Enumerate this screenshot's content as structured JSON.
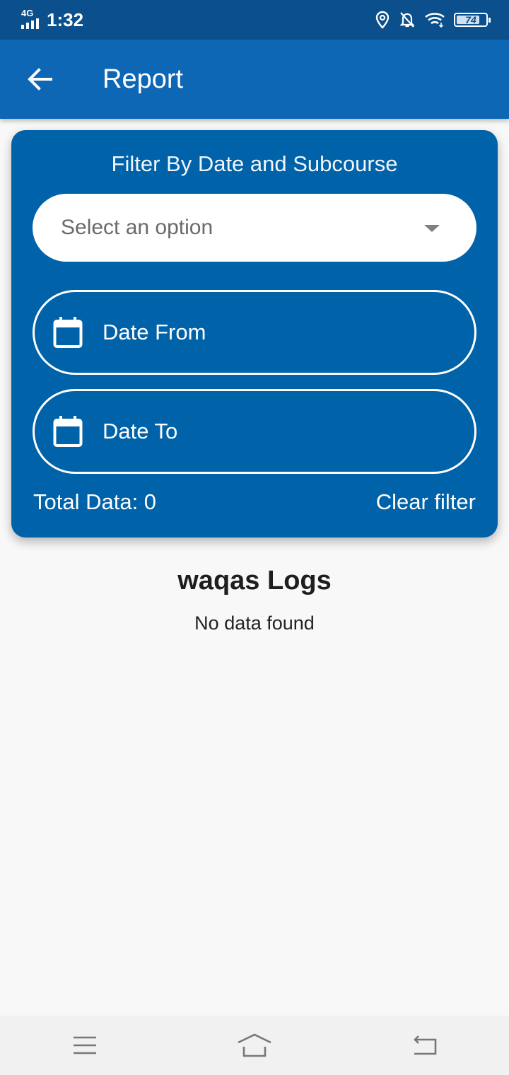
{
  "status_bar": {
    "network": "4G",
    "time": "1:32",
    "battery": "74"
  },
  "app_bar": {
    "title": "Report"
  },
  "filter": {
    "title": "Filter By Date and Subcourse",
    "select_placeholder": "Select an option",
    "date_from_label": "Date From",
    "date_to_label": "Date To",
    "total_label": "Total Data: 0",
    "clear_label": "Clear filter"
  },
  "logs": {
    "title": "waqas Logs",
    "empty_message": "No data found"
  },
  "icons": {
    "back": "arrow-left-icon",
    "calendar": "calendar-icon",
    "dropdown": "caret-down-icon",
    "location": "location-icon",
    "notifications_off": "bell-off-icon",
    "wifi": "wifi-icon",
    "nav_menu": "menu-icon",
    "nav_home": "home-icon",
    "nav_back": "back-icon"
  },
  "colors": {
    "status_bar": "#0b4f8c",
    "app_bar": "#0d67b5",
    "card": "#0062a8",
    "background": "#f8f8f8"
  }
}
